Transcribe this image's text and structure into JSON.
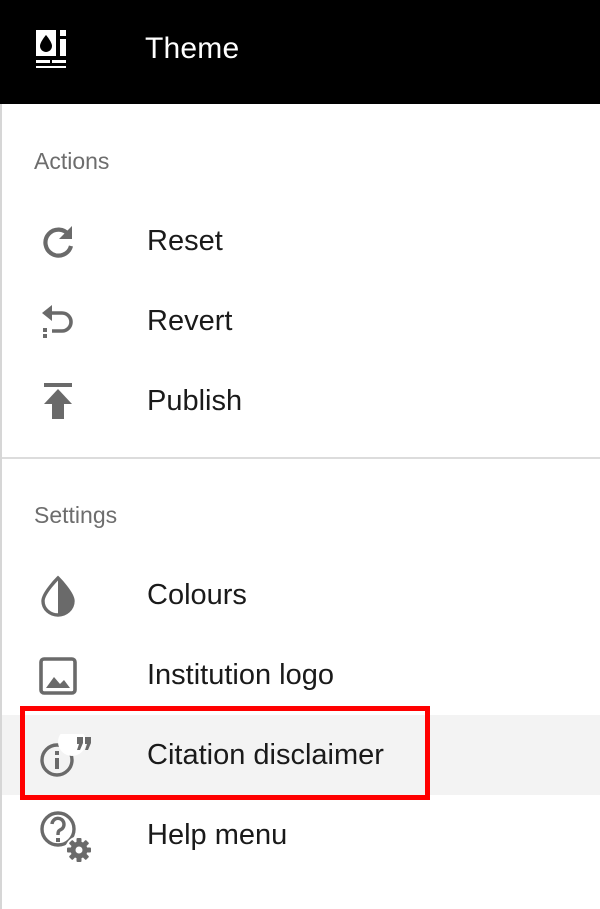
{
  "header": {
    "title": "Theme",
    "logo_icon": "theme-logo-icon",
    "background": "#000000"
  },
  "sections": {
    "actions": {
      "label": "Actions",
      "items": [
        {
          "label": "Reset",
          "icon": "refresh-icon"
        },
        {
          "label": "Revert",
          "icon": "undo-icon"
        },
        {
          "label": "Publish",
          "icon": "publish-icon"
        }
      ]
    },
    "settings": {
      "label": "Settings",
      "items": [
        {
          "label": "Colours",
          "icon": "contrast-icon"
        },
        {
          "label": "Institution logo",
          "icon": "image-icon"
        },
        {
          "label": "Citation disclaimer",
          "icon": "citation-info-icon",
          "selected": true
        },
        {
          "label": "Help menu",
          "icon": "help-settings-icon"
        }
      ]
    }
  },
  "colors": {
    "highlight_border": "#ff0000",
    "selected_background": "#f3f3f3",
    "icon_color": "#6a6a6a",
    "section_label_color": "#6d6d6d"
  }
}
